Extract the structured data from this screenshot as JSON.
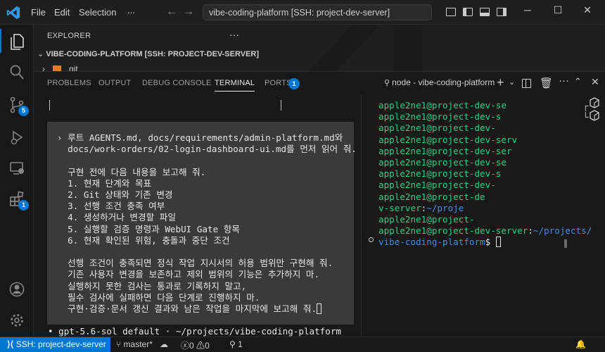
{
  "menu": {
    "file": "File",
    "edit": "Edit",
    "selection": "Selection",
    "more": "..."
  },
  "title": {
    "command_center": "vibe-coding-platform [SSH: project-dev-server]"
  },
  "explorer": {
    "title": "EXPLORER",
    "more": "···",
    "workspace": "VIBE-CODING-PLATFORM [SSH: PROJECT-DEV-SERVER]",
    "git_folder": ".git"
  },
  "activity": {
    "source_control_badge": "5",
    "extensions_badge": "1"
  },
  "panel": {
    "tabs": [
      "PROBLEMS",
      "OUTPUT",
      "DEBUG CONSOLE",
      "TERMINAL",
      "PORTS"
    ],
    "ports_badge": "1",
    "terminal_name": "node - vibe-coding-platform",
    "more": "···"
  },
  "left_terminal": {
    "lines": [
      "› 루트 AGENTS.md, docs/requirements/admin-platform.md와",
      "  docs/work-orders/02-login-dashboard-ui.md를 먼저 읽어 줘.",
      "",
      "  구현 전에 다음 내용을 보고해 줘.",
      "  1. 현재 단계와 목표",
      "  2. Git 상태와 기존 변경",
      "  3. 선행 조건 충족 여부",
      "  4. 생성하거나 변경할 파일",
      "  5. 실행할 검증 명령과 WebUI Gate 항목",
      "  6. 현재 확인된 위험, 충돌과 중단 조건",
      "",
      "  선행 조건이 충족되면 정식 작업 지시서의 허용 범위만 구현해 줘.",
      "  기존 사용자 변경을 보존하고 제외 범위의 기능은 추가하지 마.",
      "  실행하지 못한 검사는 통과로 기록하지 말고,",
      "  필수 검사에 실패하면 다음 단계로 진행하지 마.",
      "  구현·검증·문서 갱신 결과와 남은 작업을 마지막에 보고해 줘."
    ],
    "status": "• gpt-5.6-sol default · ~/projects/vibe-coding-platform"
  },
  "right_terminal": {
    "lines": [
      {
        "parts": [
          {
            "t": "apple2ne1@project-dev-se",
            "c": "green"
          }
        ]
      },
      {
        "parts": [
          {
            "t": "apple2ne1@project-dev-s",
            "c": "green"
          }
        ]
      },
      {
        "parts": [
          {
            "t": "apple2ne1@project-dev-",
            "c": "green"
          }
        ]
      },
      {
        "parts": [
          {
            "t": "apple2ne1@project-dev-serv",
            "c": "green"
          }
        ]
      },
      {
        "parts": [
          {
            "t": "apple2ne1@project-dev-ser",
            "c": "green"
          }
        ]
      },
      {
        "parts": [
          {
            "t": "apple2ne1@project-dev-se",
            "c": "green"
          }
        ]
      },
      {
        "parts": [
          {
            "t": "apple2ne1@project-dev-s",
            "c": "green"
          }
        ]
      },
      {
        "parts": [
          {
            "t": "apple2ne1@project-dev-",
            "c": "green"
          }
        ]
      },
      {
        "parts": [
          {
            "t": "apple2ne1@project-de",
            "c": "green"
          }
        ]
      },
      {
        "parts": [
          {
            "t": "v-server",
            "c": "green"
          },
          {
            "t": ":",
            "c": "white"
          },
          {
            "t": "~/proje",
            "c": "blue"
          }
        ]
      },
      {
        "parts": [
          {
            "t": "apple2ne1@project-",
            "c": "green"
          }
        ]
      },
      {
        "parts": [
          {
            "t": "apple2ne1@project-dev-server",
            "c": "green"
          },
          {
            "t": ":",
            "c": "white"
          },
          {
            "t": "~/projects/",
            "c": "blue"
          }
        ]
      },
      {
        "parts": [
          {
            "t": "vibe-coding-platform",
            "c": "blue"
          },
          {
            "t": "$ ",
            "c": "white"
          }
        ]
      }
    ]
  },
  "statusbar": {
    "remote": "SSH: project-dev-server",
    "branch": "master*",
    "errors": "0",
    "warnings": "0",
    "ports": "1"
  }
}
